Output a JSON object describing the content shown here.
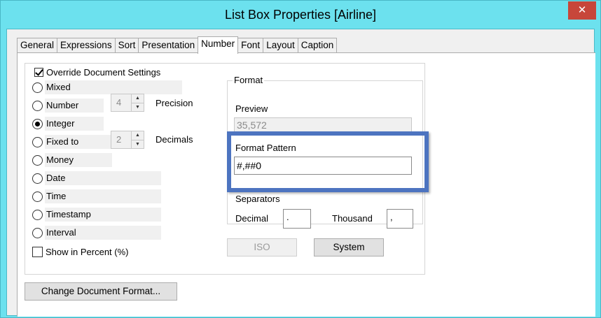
{
  "window": {
    "title": "List Box Properties [Airline]",
    "close_glyph": "✕"
  },
  "tabs": [
    {
      "label": "General",
      "active": false
    },
    {
      "label": "Expressions",
      "active": false
    },
    {
      "label": "Sort",
      "active": false
    },
    {
      "label": "Presentation",
      "active": false
    },
    {
      "label": "Number",
      "active": true
    },
    {
      "label": "Font",
      "active": false
    },
    {
      "label": "Layout",
      "active": false
    },
    {
      "label": "Caption",
      "active": false
    }
  ],
  "override": {
    "label": "Override Document Settings",
    "checked": true
  },
  "number_types": [
    {
      "label": "Mixed",
      "checked": false
    },
    {
      "label": "Number",
      "checked": false
    },
    {
      "label": "Integer",
      "checked": true
    },
    {
      "label": "Fixed to",
      "checked": false
    },
    {
      "label": "Money",
      "checked": false
    },
    {
      "label": "Date",
      "checked": false
    },
    {
      "label": "Time",
      "checked": false
    },
    {
      "label": "Timestamp",
      "checked": false
    },
    {
      "label": "Interval",
      "checked": false
    }
  ],
  "precision": {
    "label": "Precision",
    "value": "4"
  },
  "decimals": {
    "label": "Decimals",
    "value": "2"
  },
  "show_percent": {
    "label": "Show in Percent (%)",
    "checked": false
  },
  "format": {
    "legend": "Format",
    "preview_label": "Preview",
    "preview_value": "35,572",
    "pattern_label": "Format Pattern",
    "pattern_value": "#,##0"
  },
  "separators": {
    "legend": "Separators",
    "decimal_label": "Decimal",
    "decimal_value": ".",
    "thousand_label": "Thousand",
    "thousand_value": ","
  },
  "buttons": {
    "iso": "ISO",
    "system": "System",
    "change_doc_format": "Change Document Format..."
  },
  "colors": {
    "titlebar": "#6ce1ee",
    "close_button": "#c7463a",
    "highlight_box": "#4d74c0"
  }
}
